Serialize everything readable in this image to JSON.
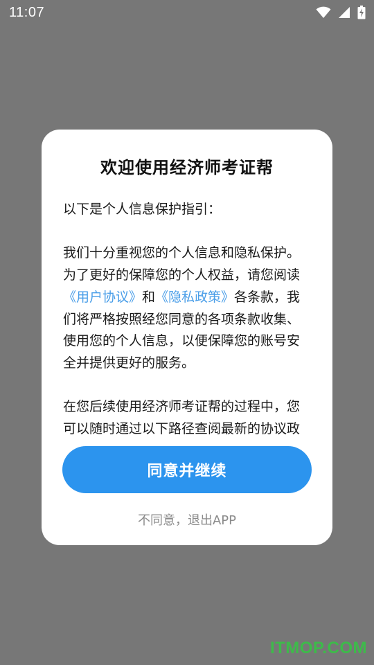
{
  "status_bar": {
    "time": "11:07",
    "icons": [
      "wifi-icon",
      "signal-icon",
      "battery-charging-icon"
    ]
  },
  "dialog": {
    "title": "欢迎使用经济师考证帮",
    "intro": "以下是个人信息保护指引：",
    "para2": {
      "before": "我们十分重视您的个人信息和隐私保护。为了更好的保障您的个人权益，请您阅读",
      "user_agreement_link": "《用户协议》",
      "and": "和",
      "privacy_policy_link": "《隐私政策》",
      "after": "各条款，我们将严格按照经您同意的各项条款收集、使用您的个人信息，以便保障您的账号安全并提供更好的服务。"
    },
    "para3": "在您后续使用经济师考证帮的过程中，您可以随时通过以下路径查阅最新的协议政策。",
    "agree_button": "同意并继续",
    "disagree_button": "不同意，退出APP"
  },
  "watermark": "ITMOP.COM",
  "colors": {
    "overlay": "#777777",
    "accent": "#2c94ee",
    "link": "#4a9ee8",
    "watermark": "#3dbb4a"
  }
}
